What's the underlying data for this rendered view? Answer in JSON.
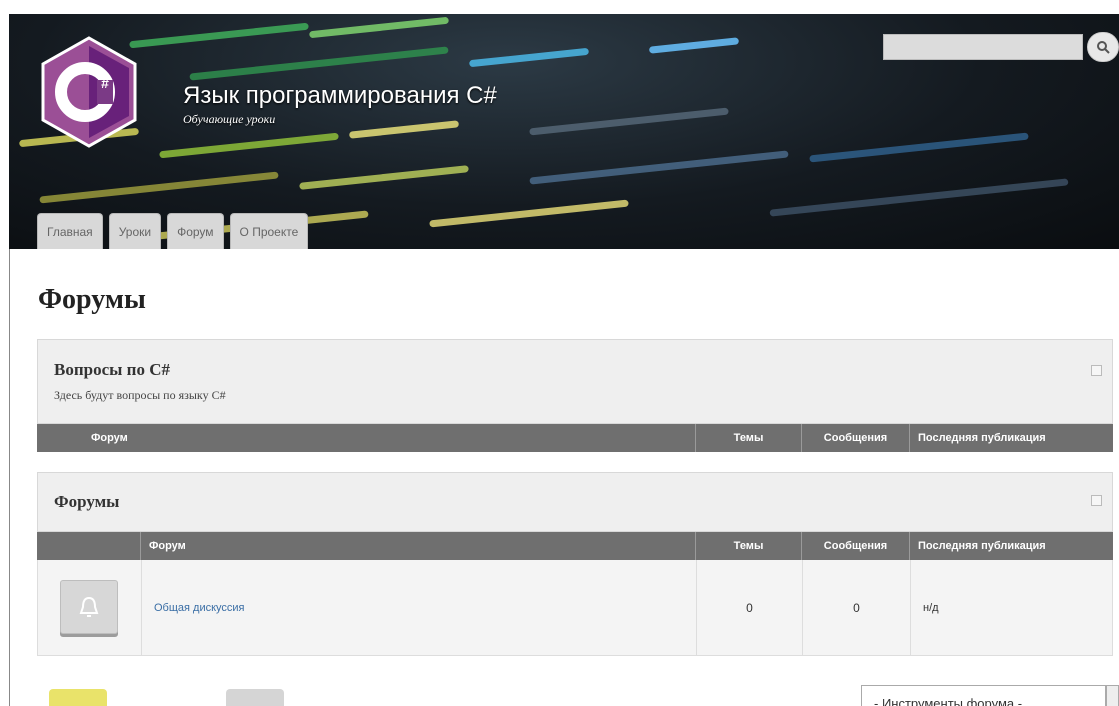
{
  "header": {
    "site_title": "Язык программирования C#",
    "site_subtitle": "Обучающие уроки",
    "logo_text": "C#",
    "search": {
      "placeholder": "",
      "button_icon": "search-icon"
    },
    "tabs": [
      {
        "label": "Главная"
      },
      {
        "label": "Уроки"
      },
      {
        "label": "Форум"
      },
      {
        "label": "О Проекте"
      }
    ]
  },
  "page": {
    "title": "Форумы"
  },
  "categories": [
    {
      "title": "Вопросы по C#",
      "description": "Здесь будут вопросы по языку C#",
      "columns": [
        "Форум",
        "Темы",
        "Сообщения",
        "Последняя публикация"
      ]
    },
    {
      "title": "Форумы",
      "columns": [
        "Форум",
        "Темы",
        "Сообщения",
        "Последняя публикация"
      ],
      "rows": [
        {
          "icon": "bell-icon",
          "name": "Общая дискуссия",
          "topics": "0",
          "posts": "0",
          "last_post": "н/д"
        }
      ]
    }
  ],
  "footer": {
    "tools_select": "- Инструменты форума -"
  },
  "colors": {
    "header_bg": "#141a20",
    "table_header": "#6f6f6f",
    "category_bg": "#efefef",
    "link": "#3a6ea5",
    "logo": "#68217a"
  }
}
